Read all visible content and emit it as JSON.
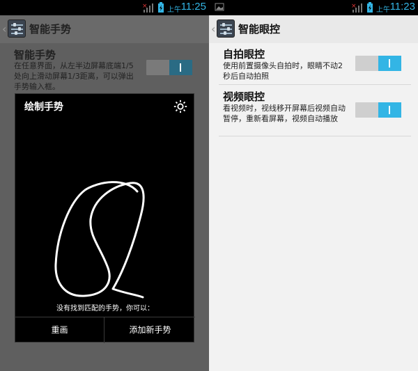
{
  "left": {
    "status": {
      "ampm": "上午",
      "time": "11:25"
    },
    "header": {
      "title": "智能手势"
    },
    "setting": {
      "title": "智能手势",
      "desc": "在任意界面，从左半边屏幕底端1/5处向上滑动屏幕1/3距离，可以弹出手势输入框。",
      "enabled": true
    },
    "dialog": {
      "title": "绘制手势",
      "hint": "没有找到匹配的手势，你可以：",
      "redraw_label": "重画",
      "add_label": "添加新手势"
    }
  },
  "right": {
    "status": {
      "ampm": "上午",
      "time": "11:23"
    },
    "header": {
      "title": "智能眼控"
    },
    "settings": [
      {
        "title": "自拍眼控",
        "desc": "使用前置摄像头自拍时，眼睛不动2秒后自动拍照",
        "enabled": true
      },
      {
        "title": "视频眼控",
        "desc": "看视频时，视线移开屏幕后视频自动暂停，重新看屏幕，视频自动播放",
        "enabled": true
      }
    ]
  },
  "colors": {
    "accent": "#33b5e5",
    "dim_accent": "#2a6b84"
  }
}
